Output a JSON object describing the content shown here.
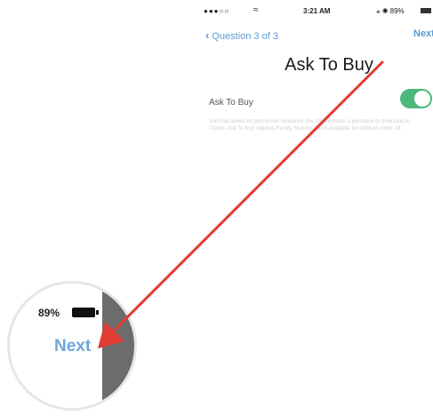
{
  "status_bar": {
    "signal": "●●●○○",
    "wifi_icon": "wifi-icon",
    "time": "3:21 AM",
    "right": "⚹ ◉ 89%",
    "battery_icon": "battery-icon"
  },
  "nav": {
    "back_label": "Question 3 of 3",
    "back_icon": "chevron-left-icon",
    "next_label": "Next"
  },
  "page": {
    "title": "Ask To Buy",
    "row_label": "Ask To Buy",
    "toggle_on": true,
    "description": "You'll be asked for permission whenever this child initiates a purchase or download in iTunes. Ask To Buy requires Family Sharing and is available for children under 18."
  },
  "magnifier": {
    "battery_text": "89%",
    "next_label": "Next"
  },
  "colors": {
    "accent": "#5b9bd5",
    "toggle": "#4cb87a",
    "arrow": "#e03c32"
  }
}
